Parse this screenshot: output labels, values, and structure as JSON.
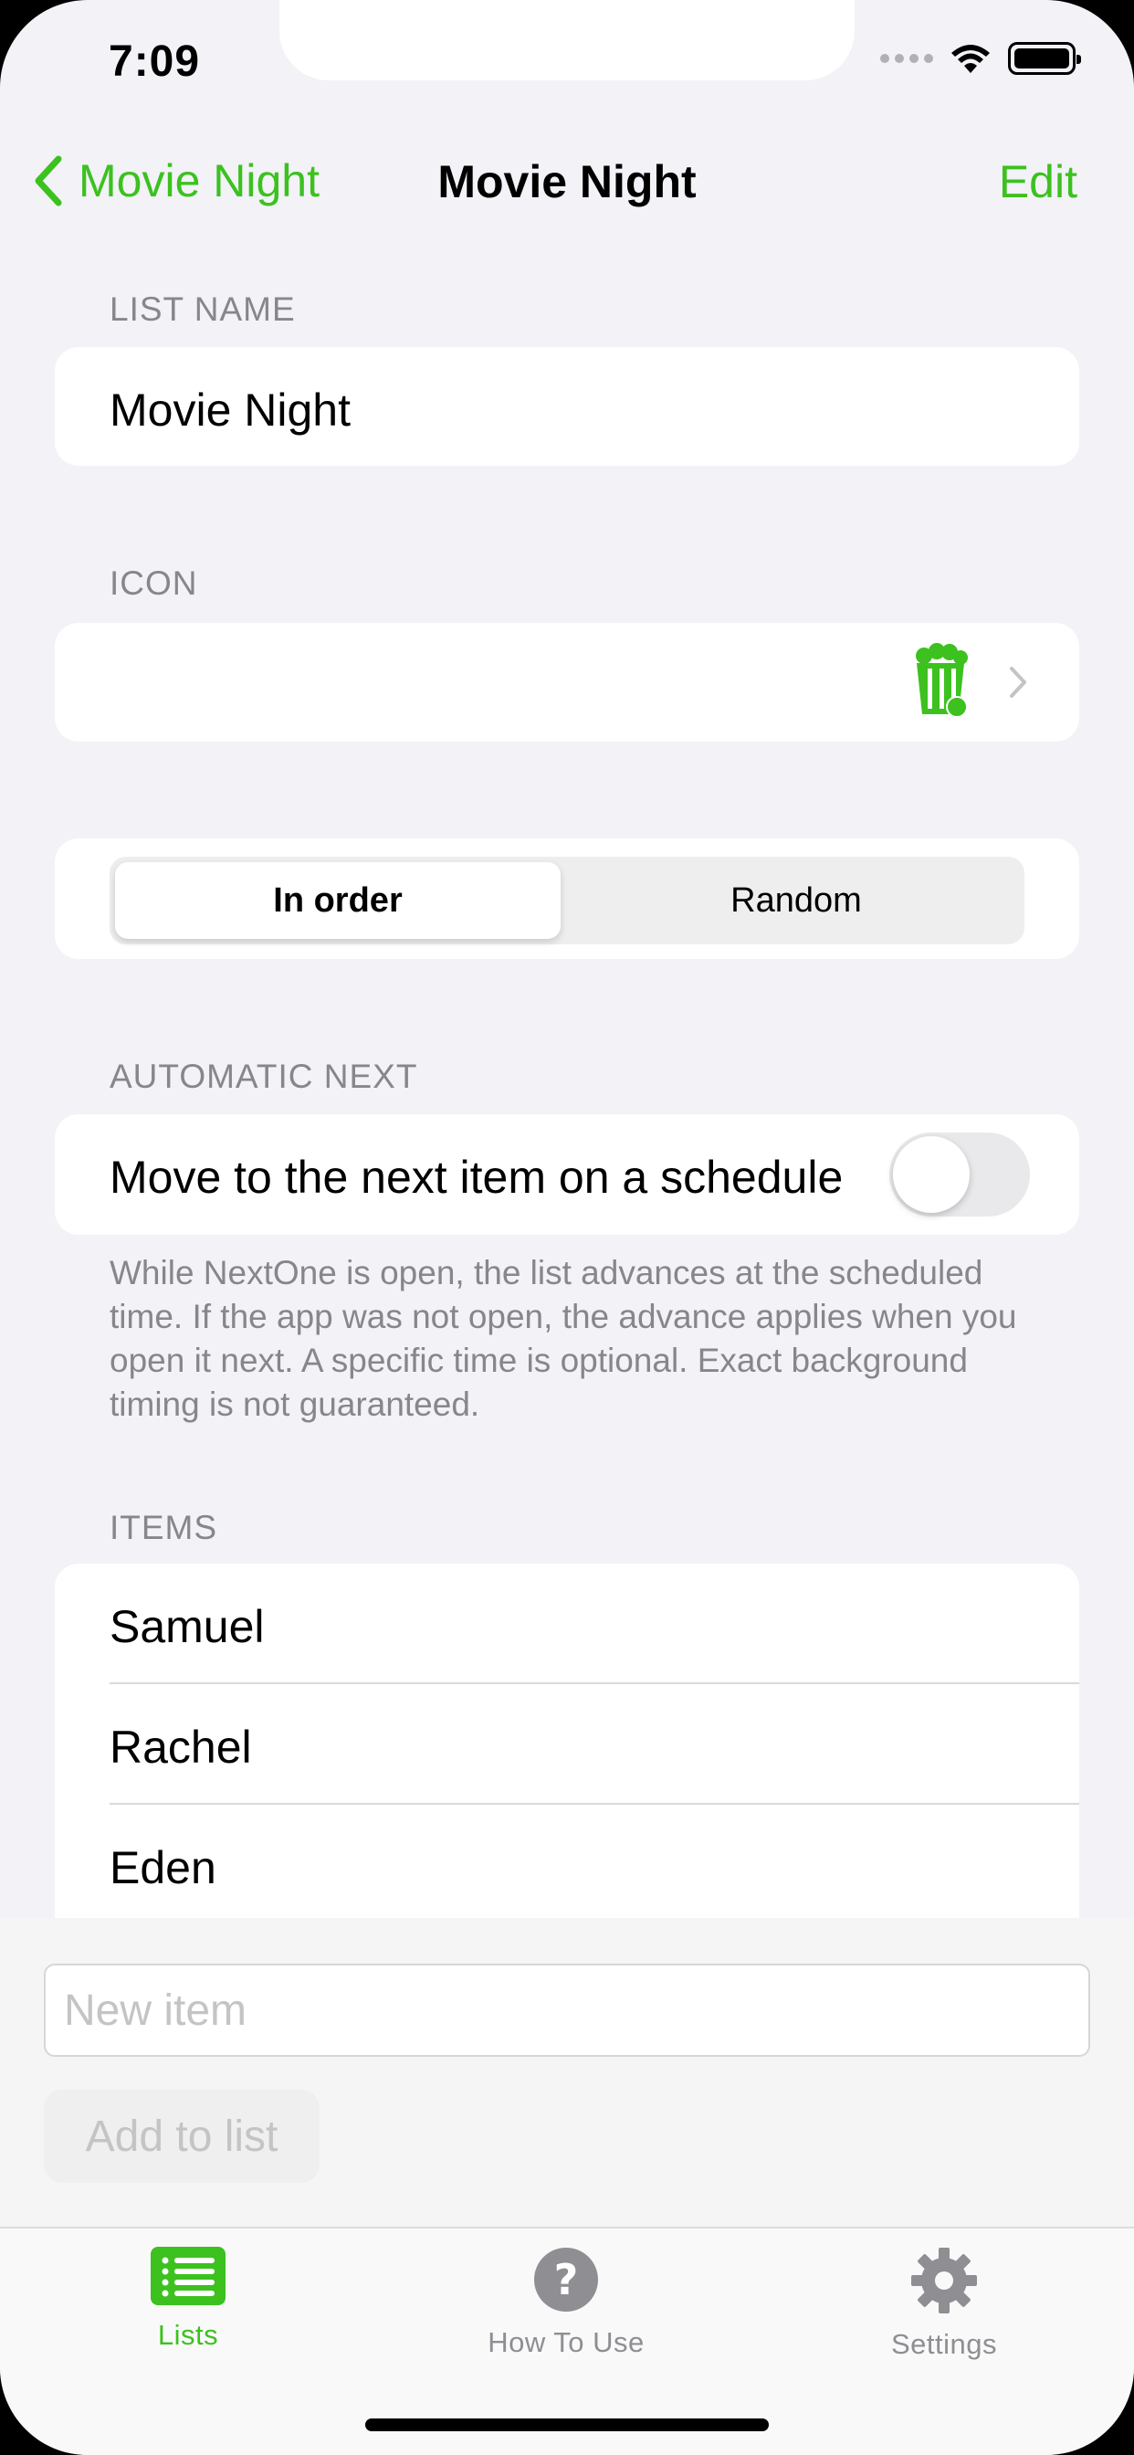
{
  "status_bar": {
    "time": "7:09"
  },
  "nav": {
    "back_label": "Movie Night",
    "title": "Movie Night",
    "edit_label": "Edit"
  },
  "list_name": {
    "header": "LIST NAME",
    "value": "Movie Night"
  },
  "icon_section": {
    "header": "ICON",
    "icon": "popcorn-icon"
  },
  "order": {
    "options": [
      "In order",
      "Random"
    ],
    "selected": "In order"
  },
  "automatic_next": {
    "header": "AUTOMATIC NEXT",
    "toggle_label": "Move to the next item on a schedule",
    "toggle_on": false,
    "footer": "While NextOne is open, the list advances at the scheduled time. If the app was not open, the advance applies when you open it next. A specific time is optional. Exact background timing is not guaranteed."
  },
  "items": {
    "header": "ITEMS",
    "list": [
      "Samuel",
      "Rachel",
      "Eden"
    ]
  },
  "input": {
    "placeholder": "New item",
    "value": "",
    "add_label": "Add to list"
  },
  "tabbar": {
    "tabs": [
      {
        "label": "Lists",
        "icon": "list-icon",
        "active": true
      },
      {
        "label": "How To Use",
        "icon": "question-icon",
        "active": false
      },
      {
        "label": "Settings",
        "icon": "gear-icon",
        "active": false
      }
    ]
  },
  "colors": {
    "accent": "#3cc11f",
    "background": "#f2f2f7",
    "secondary_text": "#86868b"
  }
}
